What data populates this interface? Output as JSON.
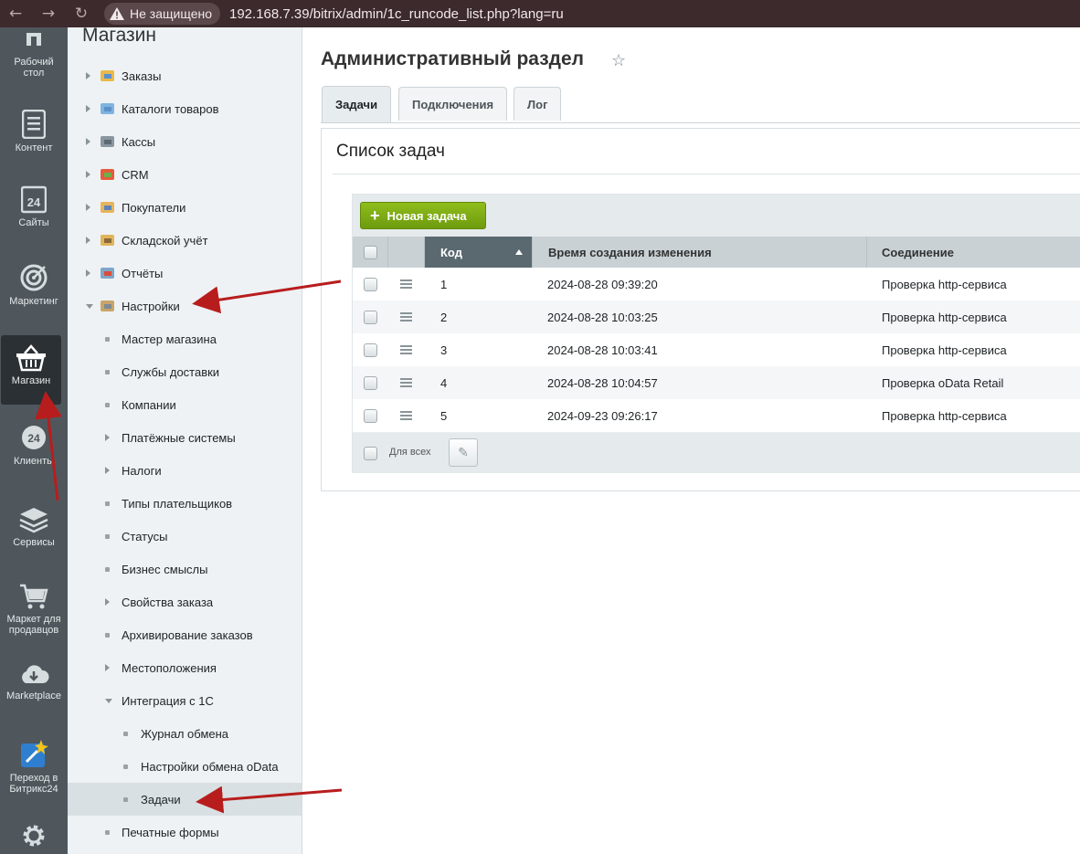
{
  "browser": {
    "back_icon": "arrow-left",
    "forward_icon": "arrow-right",
    "reload_icon": "reload",
    "security_label": "Не защищено",
    "url": "192.168.7.39/bitrix/admin/1c_runcode_list.php?lang=ru"
  },
  "left_panel": {
    "items": [
      {
        "label_line1": "Рабочий",
        "label_line2": "стол",
        "icon": "desktop-icon"
      },
      {
        "label_line1": "Контент",
        "label_line2": "",
        "icon": "content-icon"
      },
      {
        "label_line1": "Сайты",
        "label_line2": "",
        "icon": "sites-icon"
      },
      {
        "label_line1": "Маркетинг",
        "label_line2": "",
        "icon": "target-icon"
      },
      {
        "label_line1": "Магазин",
        "label_line2": "",
        "icon": "basket-icon"
      },
      {
        "label_line1": "Клиенты",
        "label_line2": "",
        "icon": "clients-icon"
      },
      {
        "label_line1": "Сервисы",
        "label_line2": "",
        "icon": "layers-icon"
      },
      {
        "label_line1": "Маркет для",
        "label_line2": "продавцов",
        "icon": "cart-icon"
      },
      {
        "label_line1": "Marketplace",
        "label_line2": "",
        "icon": "cloud-download-icon"
      },
      {
        "label_line1": "Переход в",
        "label_line2": "Битрикс24",
        "icon": "bitrix24-icon"
      },
      {
        "label_line1": "",
        "label_line2": "",
        "icon": "gear-icon"
      }
    ]
  },
  "menu": {
    "title": "Магазин",
    "items": [
      {
        "label": "Заказы"
      },
      {
        "label": "Каталоги товаров"
      },
      {
        "label": "Кассы"
      },
      {
        "label": "CRM"
      },
      {
        "label": "Покупатели"
      },
      {
        "label": "Складской учёт"
      },
      {
        "label": "Отчёты"
      },
      {
        "label": "Настройки"
      },
      {
        "label": "Мастер магазина"
      },
      {
        "label": "Службы доставки"
      },
      {
        "label": "Компании"
      },
      {
        "label": "Платёжные системы"
      },
      {
        "label": "Налоги"
      },
      {
        "label": "Типы плательщиков"
      },
      {
        "label": "Статусы"
      },
      {
        "label": "Бизнес смыслы"
      },
      {
        "label": "Свойства заказа"
      },
      {
        "label": "Архивирование заказов"
      },
      {
        "label": "Местоположения"
      },
      {
        "label": "Интеграция с 1С"
      },
      {
        "label": "Журнал обмена"
      },
      {
        "label": "Настройки обмена oData"
      },
      {
        "label": "Задачи"
      },
      {
        "label": "Печатные формы"
      }
    ]
  },
  "main": {
    "page_title": "Административный раздел",
    "tabs": [
      {
        "label": "Задачи"
      },
      {
        "label": "Подключения"
      },
      {
        "label": "Лог"
      }
    ],
    "section_title": "Список задач",
    "new_task_button": "Новая задача",
    "columns": {
      "code": "Код",
      "created": "Время создания изменения",
      "connection": "Соединение"
    },
    "rows": [
      {
        "code": "1",
        "created": "2024-08-28 09:39:20",
        "connection": "Проверка http-сервиса"
      },
      {
        "code": "2",
        "created": "2024-08-28 10:03:25",
        "connection": "Проверка http-сервиса"
      },
      {
        "code": "3",
        "created": "2024-08-28 10:03:41",
        "connection": "Проверка http-сервиса"
      },
      {
        "code": "4",
        "created": "2024-08-28 10:04:57",
        "connection": "Проверка oData Retail"
      },
      {
        "code": "5",
        "created": "2024-09-23 09:26:17",
        "connection": "Проверка http-сервиса"
      }
    ],
    "footer_label": "Для всех"
  },
  "colors": {
    "accent_green": "#7aa913",
    "annotation_arrow": "#b81d1d",
    "sidebar_dark": "#4f575d"
  }
}
